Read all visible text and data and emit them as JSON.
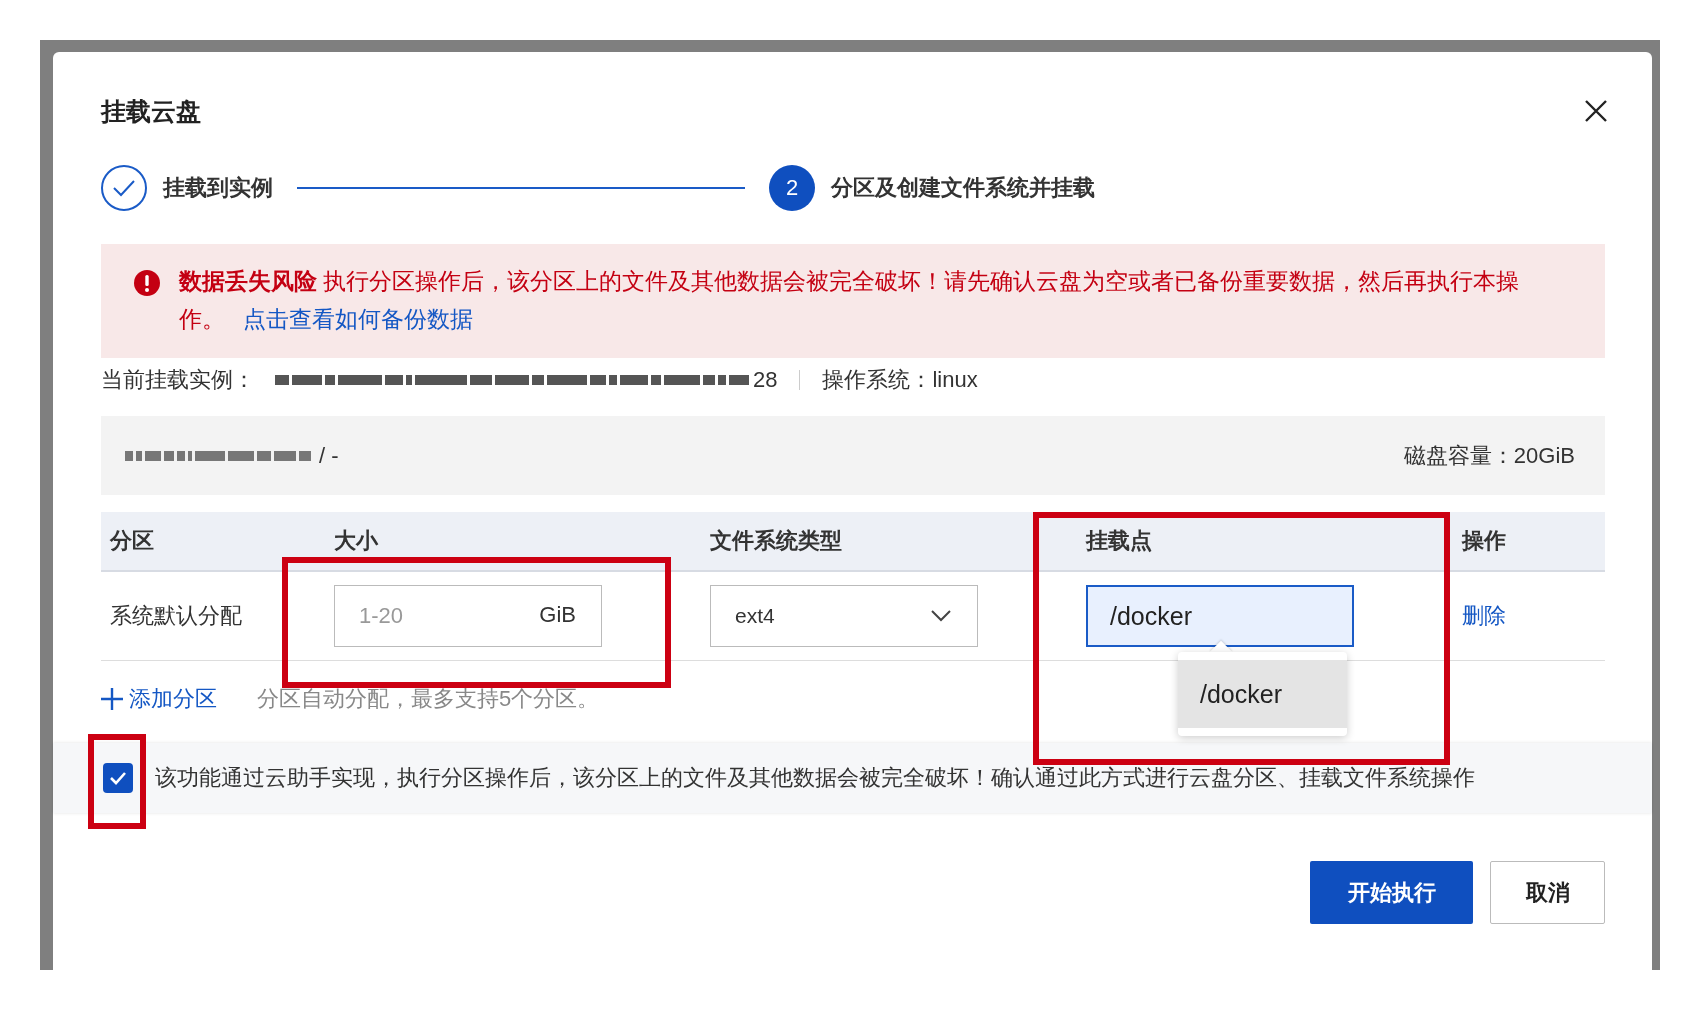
{
  "dialog": {
    "title": "挂载云盘"
  },
  "steps": [
    {
      "label": "挂载到实例",
      "done": true
    },
    {
      "label": "分区及创建文件系统并挂载",
      "number": "2",
      "done": false
    }
  ],
  "alert": {
    "title": "数据丢失风险",
    "message": "执行分区操作后，该分区上的文件及其他数据会被完全破坏！请先确认云盘为空或者已备份重要数据，然后再执行本操作。",
    "link": "点击查看如何备份数据"
  },
  "instance": {
    "label": "当前挂载实例：",
    "value_end": "28",
    "os": "操作系统：linux"
  },
  "disk": {
    "name_end": "/ -",
    "capacity": "磁盘容量：20GiB"
  },
  "table": {
    "columns": [
      "分区",
      "大小",
      "文件系统类型",
      "挂载点",
      "操作"
    ],
    "rows": [
      {
        "partition": "系统默认分配",
        "size_placeholder": "1-20",
        "unit": "GiB",
        "filesystem": "ext4",
        "mount_point": "/docker",
        "action": "删除"
      }
    ]
  },
  "add_partition": "添加分区",
  "hint": "分区自动分配，最多支持5个分区。",
  "suggestions": [
    {
      "label": "/docker",
      "selected": true
    }
  ],
  "confirm": {
    "checked": true,
    "text": "该功能通过云助手实现，执行分区操作后，该分区上的文件及其他数据会被完全破坏！确认通过此方式进行云盘分区、挂载文件系统操作"
  },
  "buttons": [
    {
      "label": "开始执行",
      "kind": "primary"
    },
    {
      "label": "取消",
      "kind": "default"
    }
  ]
}
